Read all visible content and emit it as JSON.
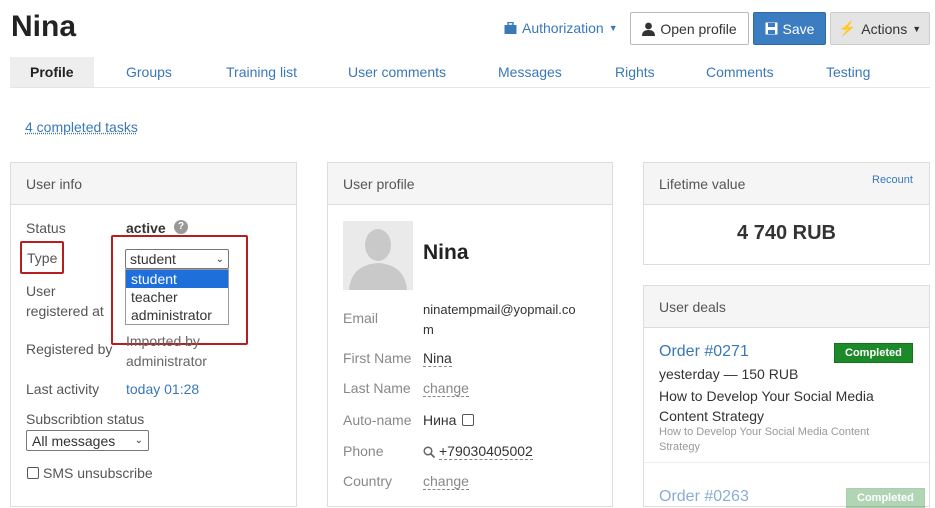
{
  "header": {
    "title": "Nina",
    "authorization": "Authorization",
    "open_profile": "Open profile",
    "save": "Save",
    "actions": "Actions"
  },
  "tabs": [
    "Profile",
    "Groups",
    "Training list",
    "User comments",
    "Messages",
    "Rights",
    "Comments",
    "Testing"
  ],
  "tasks_link": "4 completed tasks",
  "user_info": {
    "heading": "User info",
    "status_label": "Status",
    "status_value": "active",
    "type_label": "Type",
    "type_value": "student",
    "type_options": [
      "student",
      "teacher",
      "administrator"
    ],
    "registered_at_label_1": "User",
    "registered_at_label_2": "registered at",
    "registered_by_label": "Registered by",
    "registered_by_value_1": "Imported by",
    "registered_by_value_2": "administrator",
    "last_activity_label": "Last activity",
    "last_activity_value": "today 01:28",
    "subscription_label": "Subscribtion status",
    "subscription_value": "All messages",
    "sms_label": "SMS unsubscribe"
  },
  "user_profile": {
    "heading": "User profile",
    "name": "Nina",
    "email_label": "Email",
    "email_line1": "ninatempmail@yopmail.co",
    "email_line2": "m",
    "first_name_label": "First Name",
    "first_name_value": "Nina",
    "last_name_label": "Last Name",
    "last_name_value": "change",
    "auto_name_label": "Auto-name",
    "auto_name_value": "Нина",
    "phone_label": "Phone",
    "phone_value": "+79030405002",
    "country_label": "Country",
    "country_value": "change"
  },
  "lifetime": {
    "heading": "Lifetime value",
    "recount": "Recount",
    "value": "4 740 RUB"
  },
  "deals": {
    "heading": "User deals",
    "items": [
      {
        "order": "Order #0271",
        "badge": "Completed",
        "meta": "yesterday — 150 RUB",
        "title_line1": "How to Develop Your Social Media",
        "title_line2": "Content Strategy",
        "sub_line1": "How to Develop Your Social Media Content",
        "sub_line2": "Strategy"
      },
      {
        "order": "Order #0263",
        "badge": "Completed"
      }
    ]
  },
  "colors": {
    "accent": "#3b7dc0",
    "highlight": "#b81e1e",
    "completed": "#1d8a2a"
  }
}
